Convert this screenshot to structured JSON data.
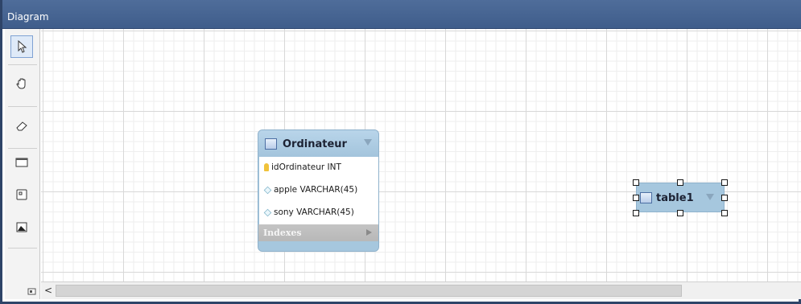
{
  "window": {
    "title": "Diagram"
  },
  "toolbar": {
    "tools": [
      {
        "name": "select-tool",
        "icon": "pointer-arrow-icon",
        "active": true
      },
      {
        "name": "hand-tool",
        "icon": "hand-icon",
        "active": false
      },
      {
        "name": "eraser-tool",
        "icon": "eraser-icon",
        "active": false
      },
      {
        "name": "layer-tool",
        "icon": "layer-icon",
        "active": false
      },
      {
        "name": "note-tool",
        "icon": "note-icon",
        "active": false
      },
      {
        "name": "image-tool",
        "icon": "image-icon",
        "active": false
      }
    ]
  },
  "diagram": {
    "tables": [
      {
        "name": "Ordinateur",
        "columns": [
          {
            "label": "idOrdinateur INT",
            "icon": "primary-key-icon"
          },
          {
            "label": "apple VARCHAR(45)",
            "icon": "column-diamond-icon"
          },
          {
            "label": "sony VARCHAR(45)",
            "icon": "column-diamond-icon"
          }
        ],
        "indexes_label": "Indexes"
      },
      {
        "name": "table1",
        "selected": true
      }
    ]
  },
  "scrollbar": {
    "left_arrow": "<"
  },
  "colors": {
    "titlebar": "#4a6894",
    "table_header": "#a6c7de",
    "grid_major": "#d8d8d8",
    "grid_minor": "#eeeeee"
  }
}
